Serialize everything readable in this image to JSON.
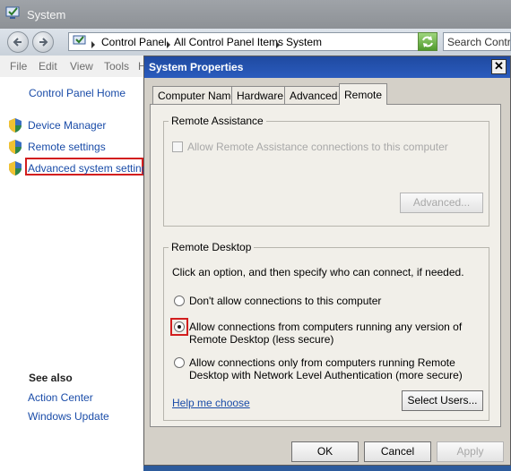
{
  "window": {
    "title": "System",
    "breadcrumbs": [
      "Control Panel",
      "All Control Panel Items",
      "System"
    ],
    "search_placeholder": "Search Control"
  },
  "menu": [
    "File",
    "Edit",
    "View",
    "Tools",
    "H"
  ],
  "left_pane": {
    "home_link": "Control Panel Home",
    "links": [
      "Device Manager",
      "Remote settings",
      "Advanced system settings"
    ],
    "see_also_title": "See also",
    "see_also": [
      "Action Center",
      "Windows Update"
    ]
  },
  "dialog": {
    "title": "System Properties",
    "close_glyph": "✕",
    "tabs": [
      "Computer Name",
      "Hardware",
      "Advanced",
      "Remote"
    ],
    "active_tab": "Remote",
    "remote_assistance": {
      "label": "Remote Assistance",
      "checkbox_label": "Allow Remote Assistance connections to this computer",
      "advanced_button": "Advanced..."
    },
    "remote_desktop": {
      "label": "Remote Desktop",
      "instruction": "Click an option, and then specify who can connect, if needed.",
      "options": [
        {
          "line1": "Don't allow connections to this computer",
          "line2": ""
        },
        {
          "line1": "Allow connections from computers running any version of",
          "line2": "Remote Desktop (less secure)"
        },
        {
          "line1": "Allow connections only from computers running Remote",
          "line2": "Desktop with Network Level Authentication (more secure)"
        }
      ],
      "selected_option": 1,
      "help_link": "Help me choose",
      "select_users_button": "Select Users..."
    },
    "buttons": {
      "ok": "OK",
      "cancel": "Cancel",
      "apply": "Apply"
    }
  },
  "colors": {
    "highlight": "#d21e1e",
    "link": "#1a4ca8",
    "title_blue": "#2a5bbd"
  }
}
